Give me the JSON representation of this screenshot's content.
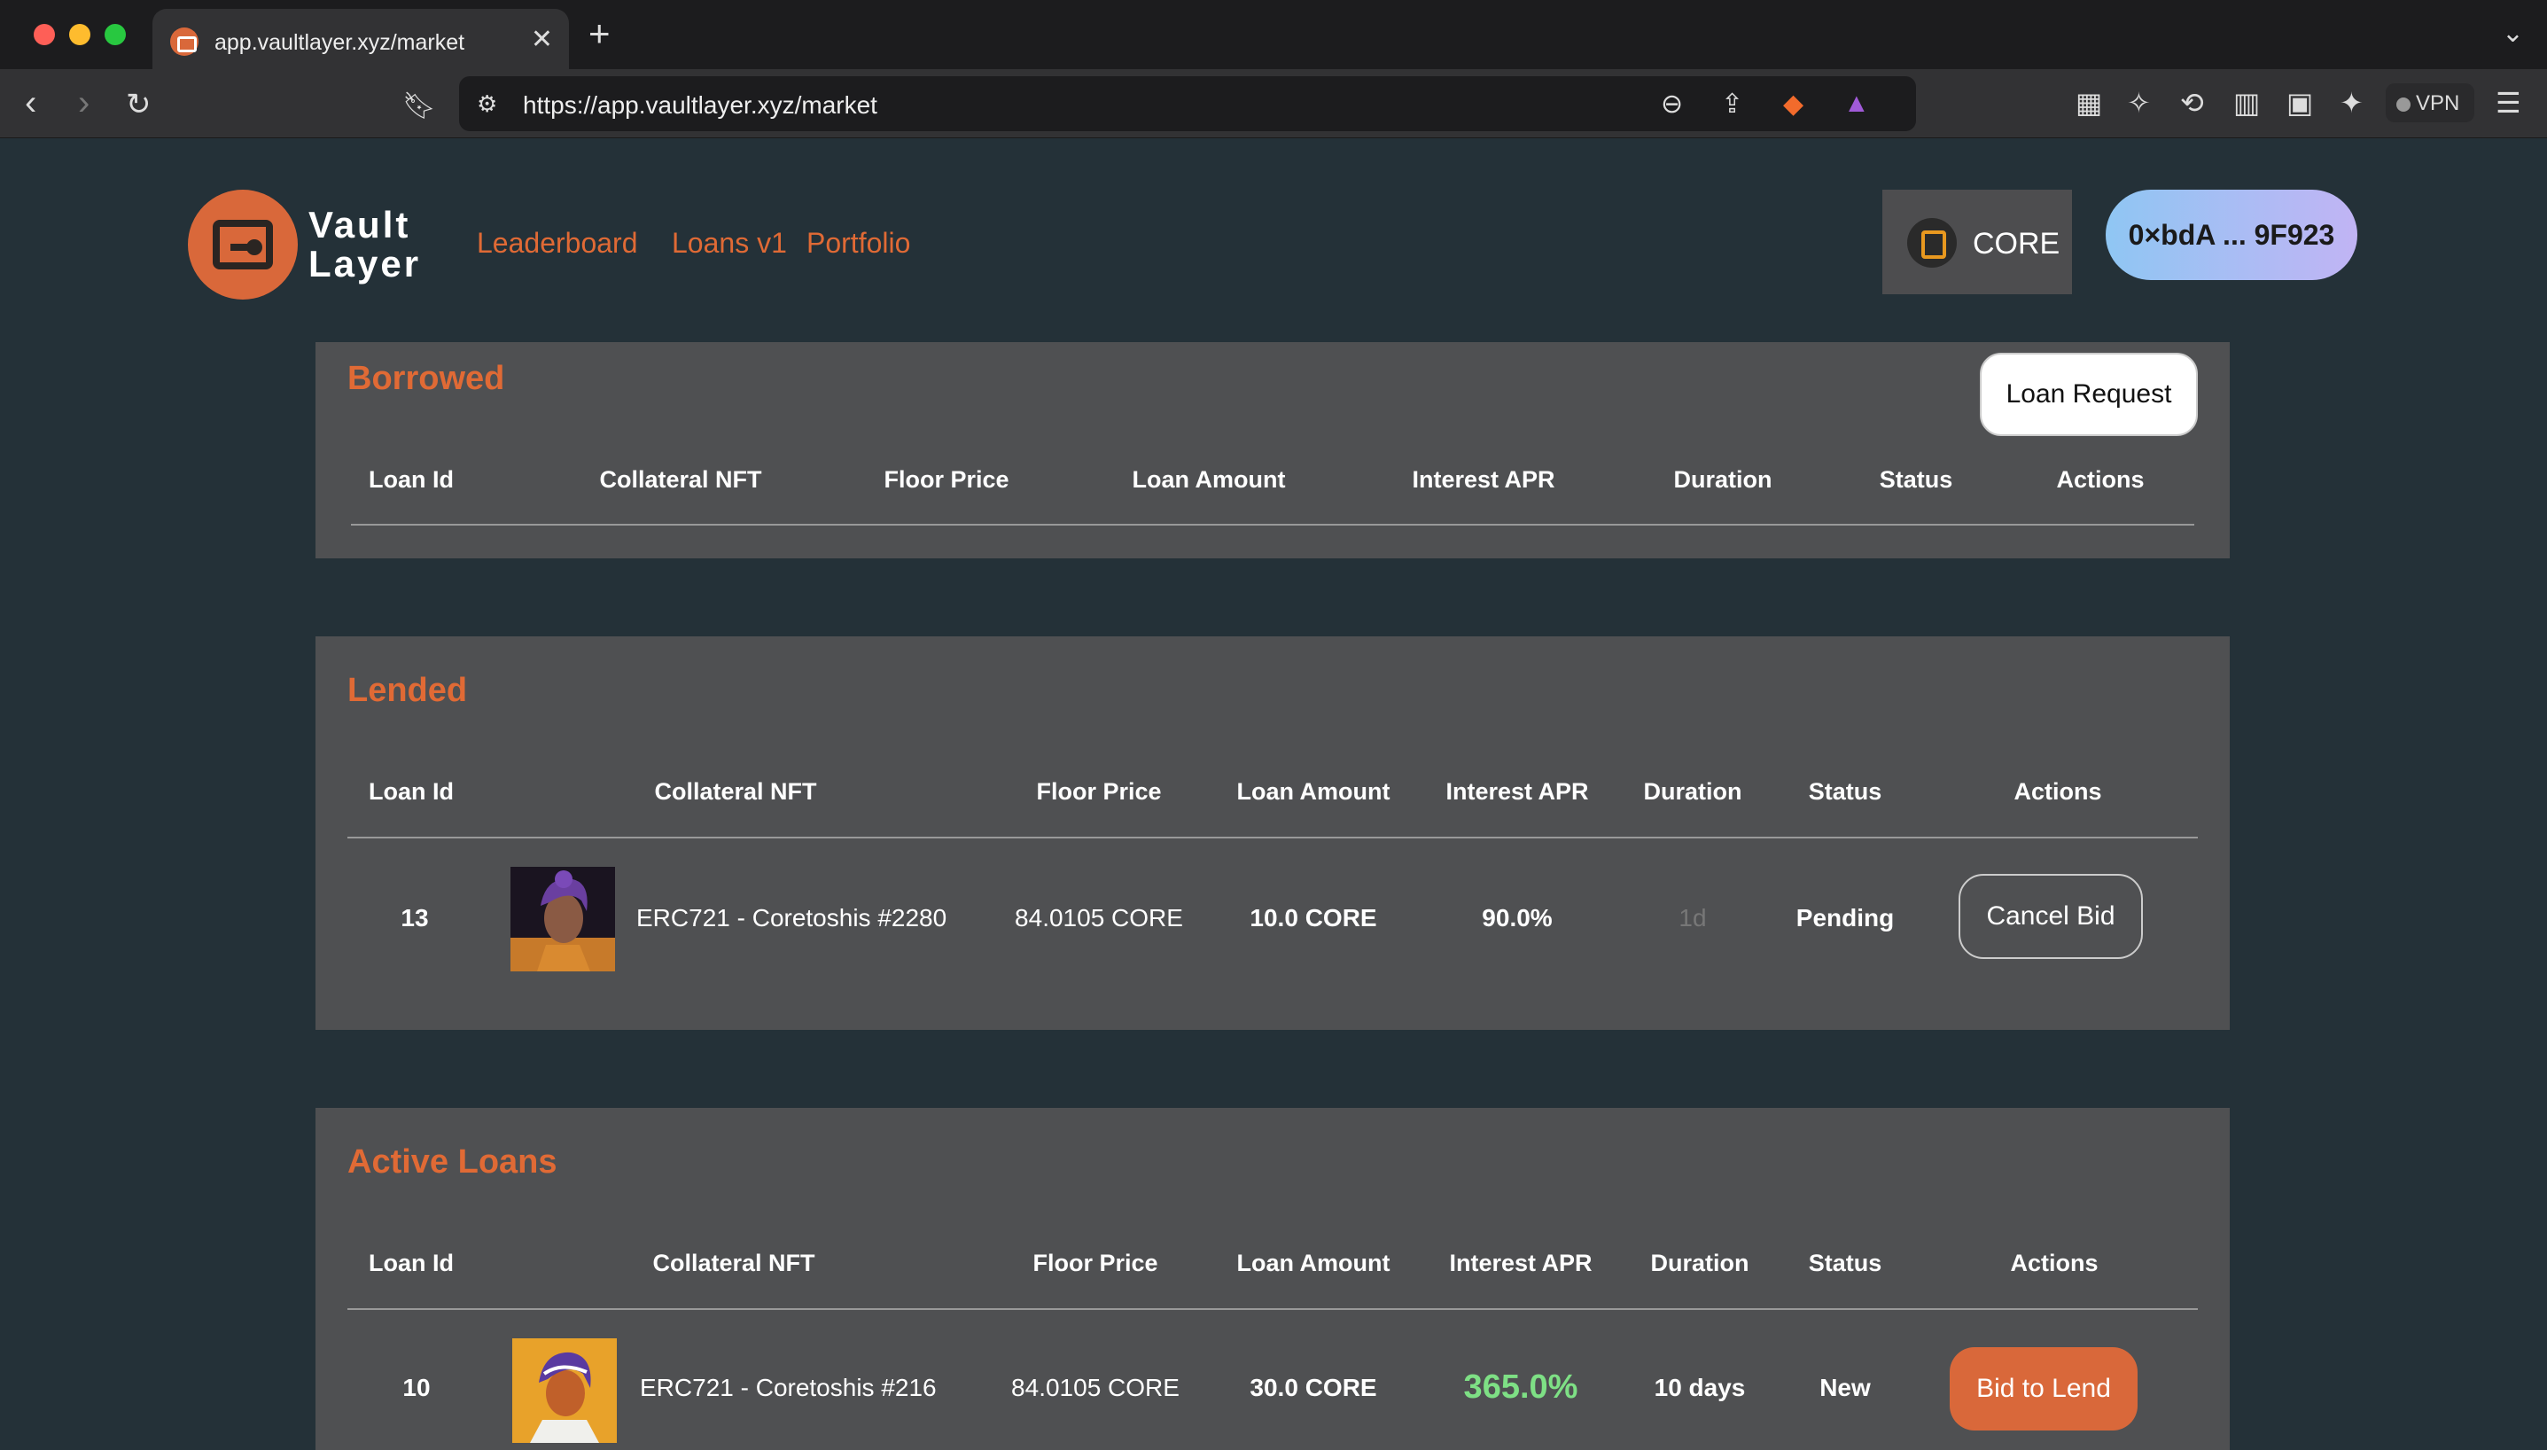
{
  "browser": {
    "tab_title": "app.vaultlayer.xyz/market",
    "url": "https://app.vaultlayer.xyz/market",
    "vpn_label": "VPN"
  },
  "app": {
    "brand_line1": "Vault",
    "brand_line2": "Layer",
    "nav": [
      "Leaderboard",
      "Loans v1",
      "Portfolio"
    ],
    "chain_label": "CORE",
    "wallet_label": "0×bdA ... 9F923",
    "accent_color": "#e06a35"
  },
  "borrowed": {
    "title": "Borrowed",
    "loan_request_label": "Loan Request",
    "columns": [
      "Loan Id",
      "Collateral NFT",
      "Floor Price",
      "Loan Amount",
      "Interest APR",
      "Duration",
      "Status",
      "Actions"
    ]
  },
  "lended": {
    "title": "Lended",
    "columns": [
      "Loan Id",
      "Collateral NFT",
      "Floor Price",
      "Loan Amount",
      "Interest APR",
      "Duration",
      "Status",
      "Actions"
    ],
    "rows": [
      {
        "loan_id": "13",
        "nft": "ERC721 - Coretoshis #2280",
        "floor_price": "84.0105 CORE",
        "loan_amount": "10.0 CORE",
        "apr": "90.0%",
        "duration": "1d",
        "status": "Pending",
        "action": "Cancel Bid"
      }
    ]
  },
  "active_loans": {
    "title": "Active Loans",
    "columns": [
      "Loan Id",
      "Collateral NFT",
      "Floor Price",
      "Loan Amount",
      "Interest APR",
      "Duration",
      "Status",
      "Actions"
    ],
    "rows": [
      {
        "loan_id": "10",
        "nft": "ERC721 - Coretoshis #216",
        "floor_price": "84.0105 CORE",
        "loan_amount": "30.0 CORE",
        "apr": "365.0%",
        "duration": "10 days",
        "status": "New",
        "action": "Bid to Lend"
      }
    ]
  }
}
